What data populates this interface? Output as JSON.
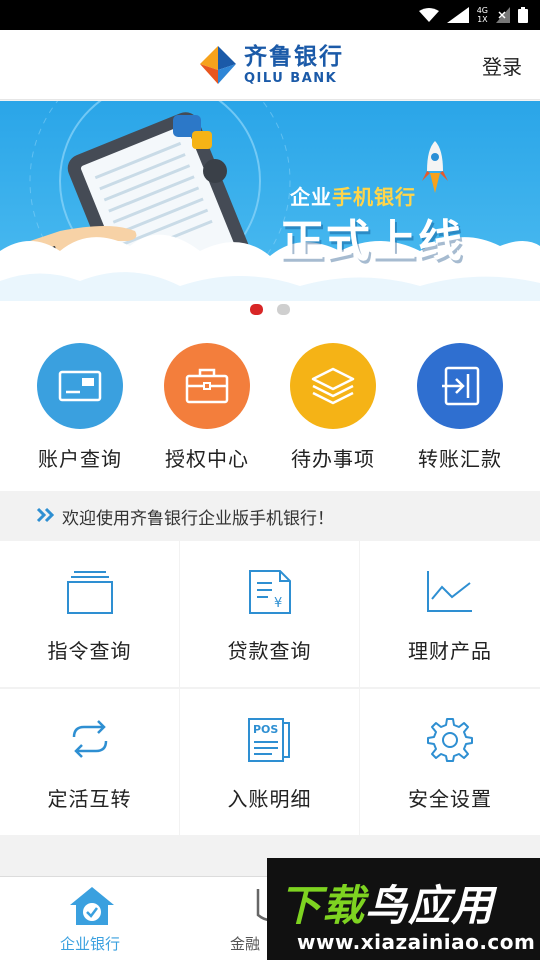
{
  "header": {
    "logo_cn": "齐鲁银行",
    "logo_en": "QILU BANK",
    "login_label": "登录"
  },
  "banner": {
    "subtitle_prefix": "企业",
    "subtitle_highlight": "手机银行",
    "title": "正式上线",
    "slide_count": 2,
    "active_slide": 1
  },
  "quick_actions": [
    {
      "label": "账户查询",
      "color": "#3aa0df",
      "icon": "card-icon"
    },
    {
      "label": "授权中心",
      "color": "#f37e3c",
      "icon": "briefcase-icon"
    },
    {
      "label": "待办事项",
      "color": "#f5b316",
      "icon": "layers-icon"
    },
    {
      "label": "转账汇款",
      "color": "#2f6fd0",
      "icon": "transfer-icon"
    }
  ],
  "notice": {
    "text": "欢迎使用齐鲁银行企业版手机银行！"
  },
  "grid": [
    {
      "label": "指令查询",
      "icon": "stack-icon"
    },
    {
      "label": "贷款查询",
      "icon": "loan-document-icon"
    },
    {
      "label": "理财产品",
      "icon": "line-chart-icon"
    },
    {
      "label": "定活互转",
      "icon": "swap-arrows-icon"
    },
    {
      "label": "入账明细",
      "icon": "pos-receipt-icon"
    },
    {
      "label": "安全设置",
      "icon": "gear-icon"
    }
  ],
  "bottom_nav": [
    {
      "label": "企业银行",
      "active": true,
      "icon": "home-icon"
    },
    {
      "label": "金融",
      "active": false,
      "icon": "finance-icon"
    }
  ],
  "watermark": {
    "title_left": "下载",
    "title_right": "鸟应用",
    "url": "www.xiazainiao.com"
  },
  "colors": {
    "accent": "#3aa0df",
    "brand": "#1b5aa8",
    "icon_line": "#2e8fd2"
  }
}
